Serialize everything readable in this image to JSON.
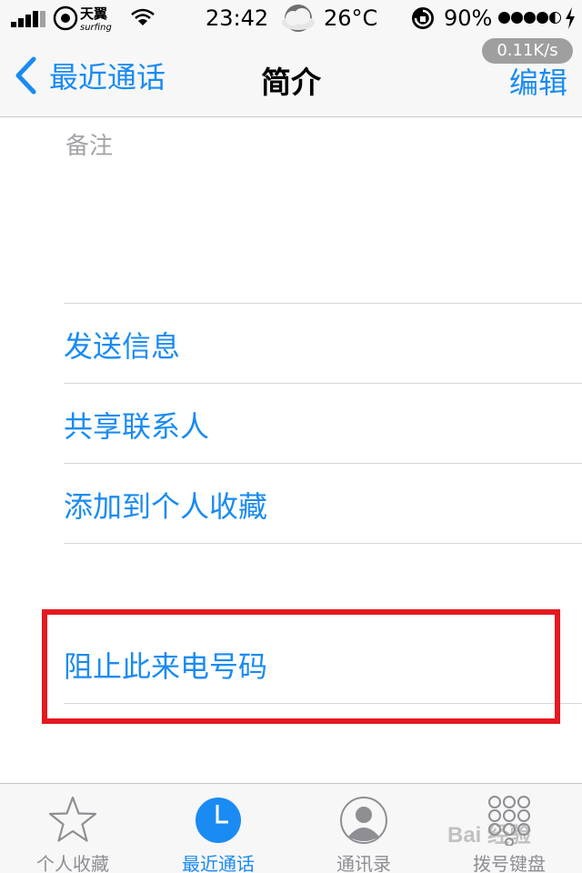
{
  "status_bar": {
    "carrier": "天翼",
    "carrier_sub": "surfing",
    "time": "23:42",
    "temperature": "26°C",
    "battery": "90%",
    "icons": [
      "signal-icon",
      "carrier-logo",
      "wifi-icon",
      "weather-icon",
      "rotation-lock-icon",
      "signal-dots-icon",
      "charging-icon"
    ]
  },
  "nav": {
    "back_label": "最近通话",
    "title": "简介",
    "edit_label": "编辑",
    "speed": "0.11K/s"
  },
  "content": {
    "notes_label": "备注",
    "actions": [
      "发送信息",
      "共享联系人",
      "添加到个人收藏"
    ],
    "block_label": "阻止此来电号码"
  },
  "tabs": [
    {
      "label": "个人收藏",
      "icon": "star-icon"
    },
    {
      "label": "最近通话",
      "icon": "clock-icon",
      "active": true
    },
    {
      "label": "通讯录",
      "icon": "contacts-icon"
    },
    {
      "label": "拨号键盘",
      "icon": "keypad-icon"
    }
  ],
  "watermark": "Bai 经验",
  "colors": {
    "accent": "#1a8bf2",
    "highlight": "#e5191f",
    "bar_bg": "#f7f7f8"
  }
}
